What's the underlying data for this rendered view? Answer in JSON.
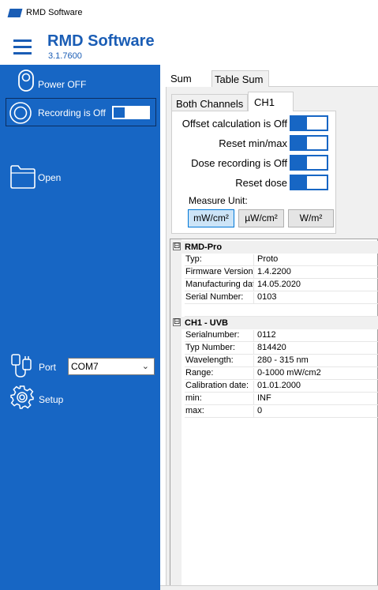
{
  "window": {
    "title": "RMD Software",
    "app_icon": "app-logo-icon"
  },
  "header": {
    "title": "RMD Software",
    "version": "3.1.7600",
    "menu_icon": "hamburger-menu-icon",
    "brand_color": "#1a5db5"
  },
  "sidebar": {
    "background": "#1766c4",
    "power": {
      "label": "Power OFF",
      "icon": "power-icon"
    },
    "recording": {
      "label": "Recording is  Off",
      "icon": "record-icon",
      "on": false
    },
    "open": {
      "label": "Open",
      "icon": "folder-icon"
    },
    "port": {
      "label": "Port",
      "icon": "usb-plug-icon",
      "value": "COM7"
    },
    "setup": {
      "label": "Setup",
      "icon": "gear-icon"
    }
  },
  "tabs": {
    "top": [
      {
        "label": "Sum",
        "selected": true
      },
      {
        "label": "Table Sum",
        "selected": false
      }
    ],
    "sub": [
      {
        "label": "Both Channels",
        "selected": false
      },
      {
        "label": "CH1",
        "selected": true
      }
    ]
  },
  "controls": {
    "offset_label": "Offset calculation is Off",
    "reset_minmax_label": "Reset min/max",
    "dose_recording_label": "Dose recording is Off",
    "reset_dose_label": "Reset dose",
    "measure_unit_label": "Measure Unit:",
    "units": [
      {
        "label": "mW/cm²",
        "selected": true
      },
      {
        "label": "µW/cm²",
        "selected": false
      },
      {
        "label": "W/m²",
        "selected": false
      }
    ]
  },
  "property_grid": {
    "device": {
      "title": "RMD-Pro",
      "expander": "⊟",
      "rows": [
        {
          "key": "Typ:",
          "value": "Proto"
        },
        {
          "key": "Firmware Version:",
          "value": "1.4.2200"
        },
        {
          "key": "Manufacturing date:",
          "value": "14.05.2020"
        },
        {
          "key": "Serial Number:",
          "value": "0103"
        }
      ]
    },
    "channel": {
      "title": "CH1 - UVB",
      "expander": "⊟",
      "rows": [
        {
          "key": "Serialnumber:",
          "value": "0112"
        },
        {
          "key": "Typ Number:",
          "value": "814420"
        },
        {
          "key": "Wavelength:",
          "value": "280 - 315 nm"
        },
        {
          "key": "Range:",
          "value": "0-1000 mW/cm2"
        },
        {
          "key": "Calibration date:",
          "value": "01.01.2000"
        },
        {
          "key": "min:",
          "value": "INF"
        },
        {
          "key": "max:",
          "value": "0"
        }
      ]
    }
  }
}
